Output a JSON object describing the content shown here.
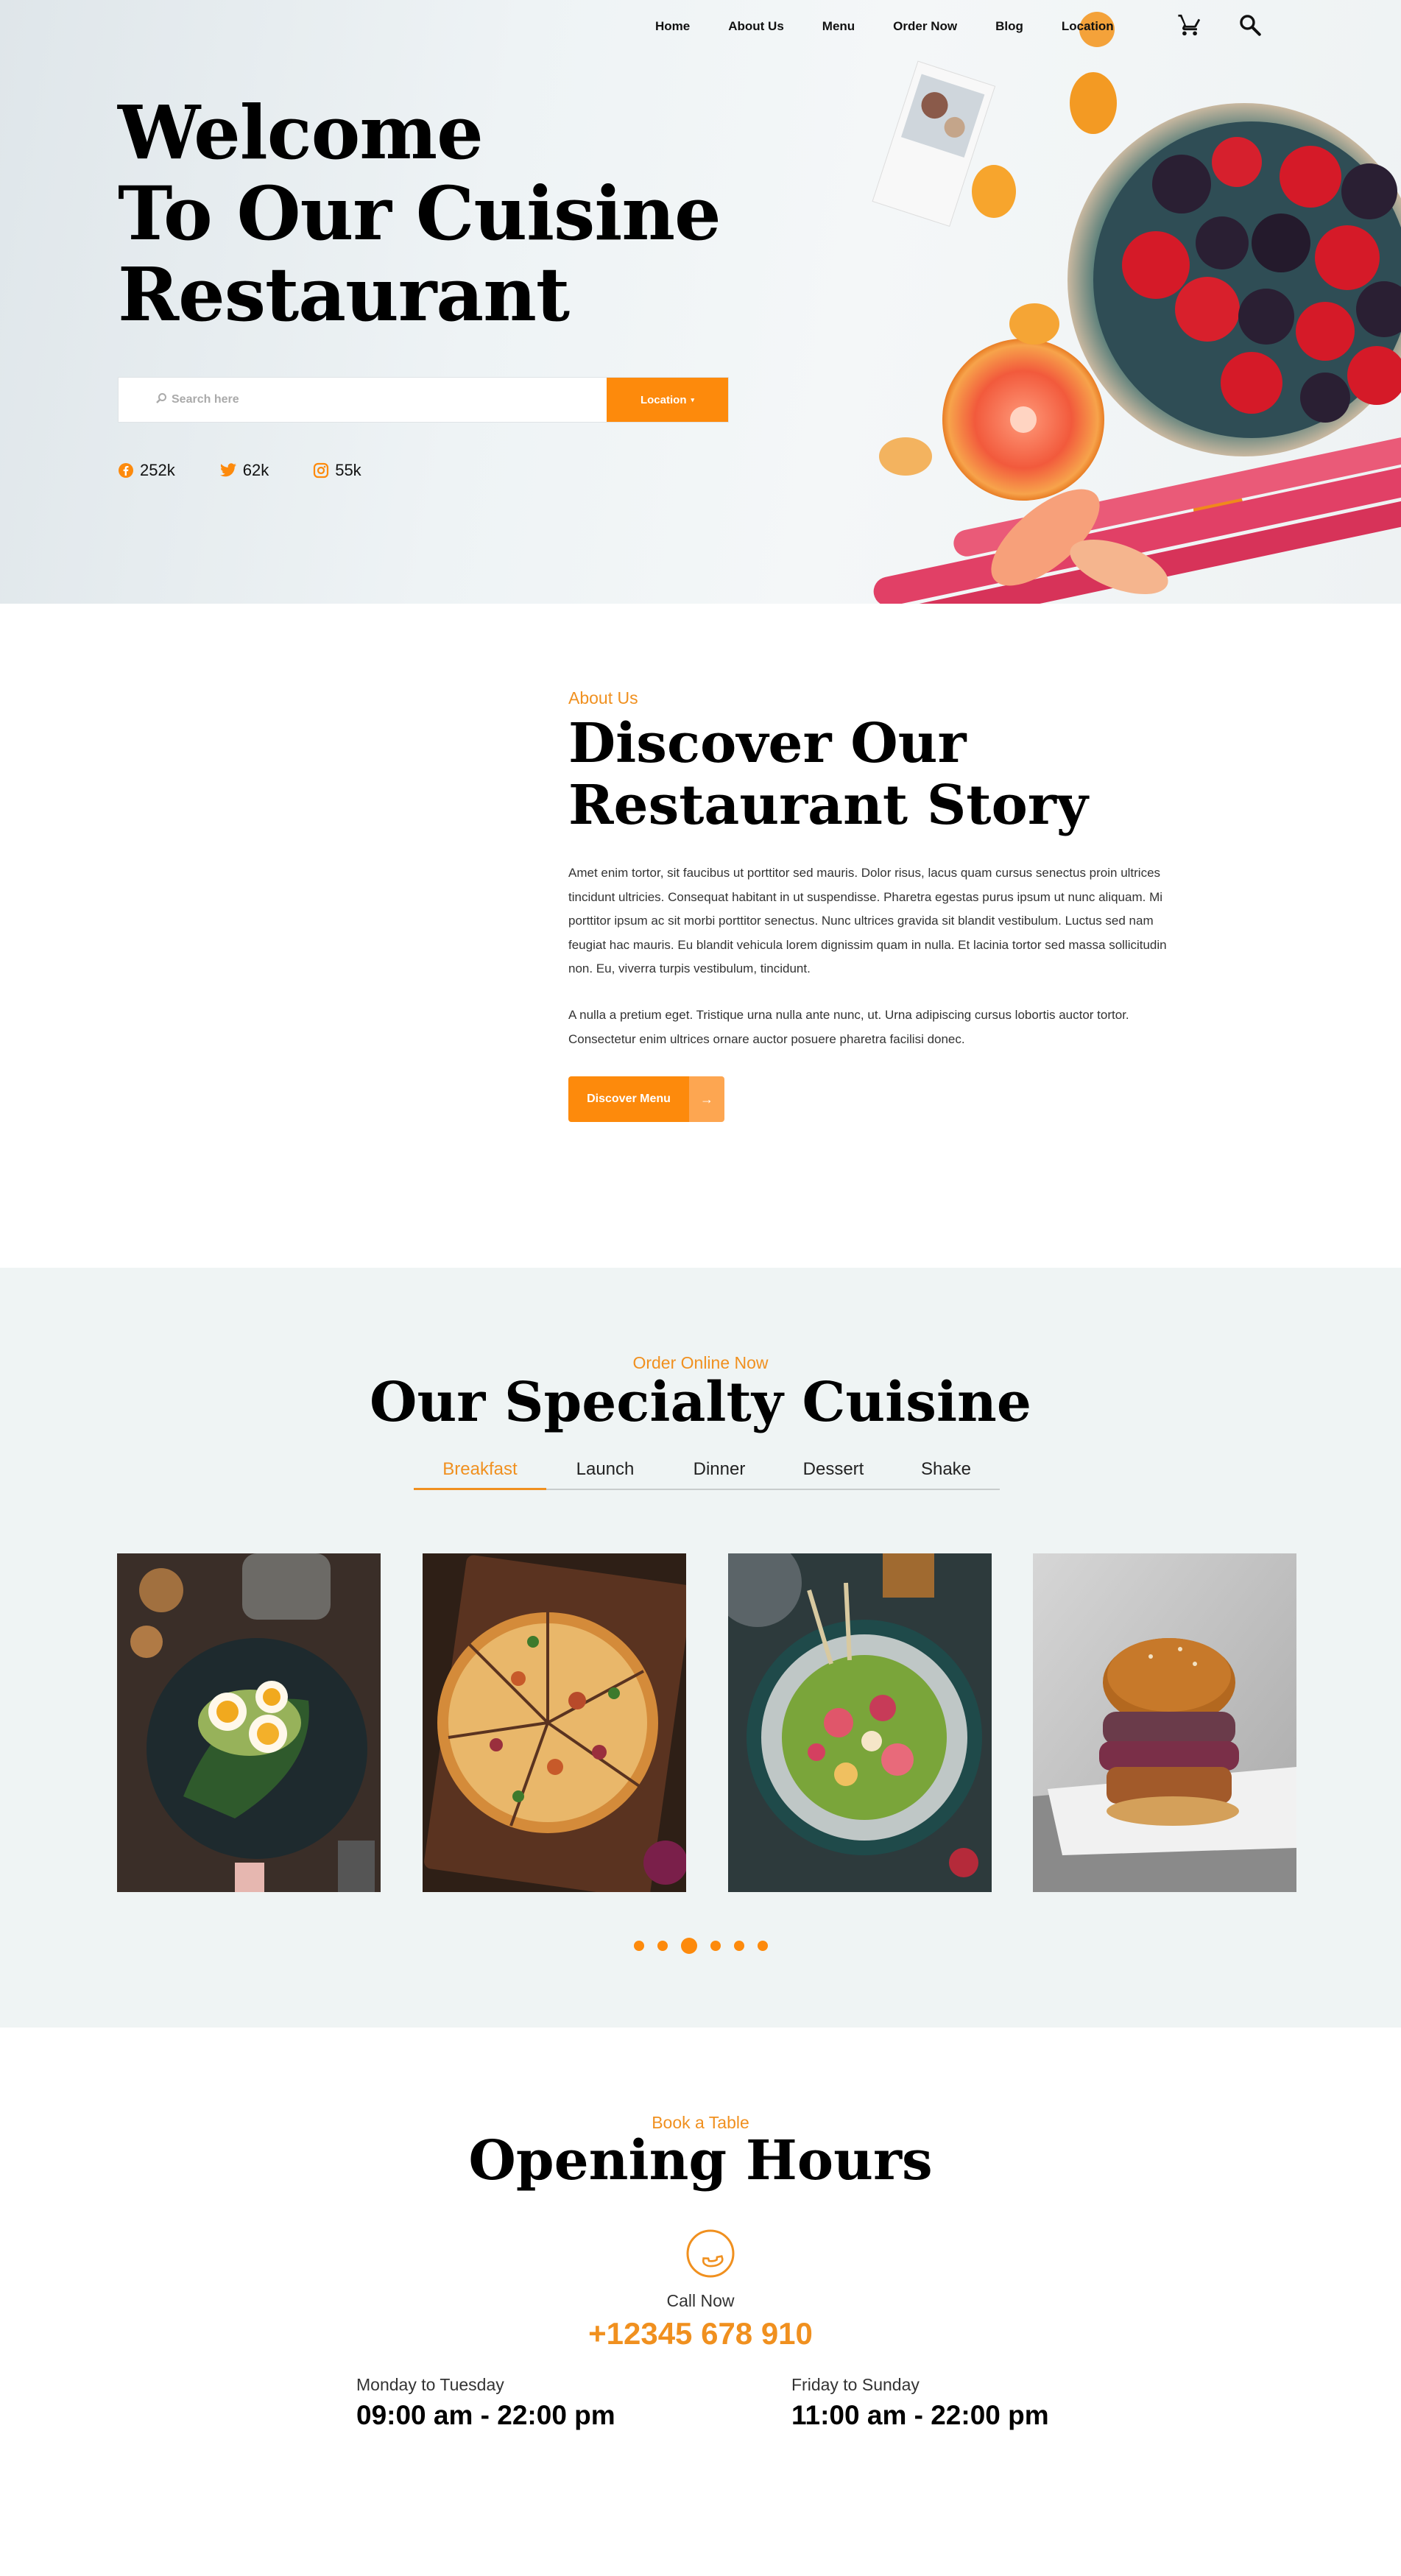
{
  "nav": {
    "links": [
      "Home",
      "About Us",
      "Menu",
      "Order Now",
      "Blog",
      "Location"
    ],
    "cart_icon": "cart-icon",
    "search_icon": "search-icon"
  },
  "hero": {
    "title_lines": [
      "Welcome",
      "To Our Cuisine",
      "Restaurant"
    ],
    "search_placeholder": "Search here",
    "location_button": "Location",
    "socials": [
      {
        "network": "facebook",
        "count": "252k"
      },
      {
        "network": "twitter",
        "count": "62k"
      },
      {
        "network": "instagram",
        "count": "55k"
      }
    ]
  },
  "about": {
    "eyebrow": "About Us",
    "title_lines": [
      "Discover Our",
      "Restaurant Story"
    ],
    "paragraph1": "Amet enim tortor, sit faucibus ut porttitor sed mauris. Dolor risus, lacus quam cursus senectus proin ultrices tincidunt ultricies. Consequat habitant in ut suspendisse. Pharetra egestas purus ipsum ut nunc aliquam. Mi porttitor ipsum ac sit morbi porttitor senectus. Nunc ultrices gravida sit blandit vestibulum. Luctus sed nam feugiat hac mauris. Eu blandit vehicula lorem dignissim quam in nulla. Et lacinia tortor sed massa sollicitudin non. Eu, viverra turpis vestibulum, tincidunt.",
    "paragraph2": "A nulla a pretium eget. Tristique urna nulla ante nunc, ut. Urna adipiscing cursus lobortis auctor tortor. Consectetur enim ultrices ornare auctor posuere pharetra facilisi donec.",
    "button": "Discover Menu",
    "button_arrow": "→"
  },
  "specialty": {
    "eyebrow": "Order Online Now",
    "title": "Our Specialty Cuisine",
    "tabs": [
      "Breakfast",
      "Launch",
      "Dinner",
      "Dessert",
      "Shake"
    ],
    "active_tab": "Breakfast",
    "dishes": [
      "egg-avocado-toast",
      "pizza",
      "salad-bowl",
      "burger"
    ],
    "dots_count": 6,
    "active_dot": 2
  },
  "hours": {
    "eyebrow": "Book a Table",
    "title": "Opening Hours",
    "call_label": "Call Now",
    "phone": "+12345 678 910",
    "schedule": [
      {
        "days": "Monday to Tuesday",
        "time": "09:00 am - 22:00 pm"
      },
      {
        "days": "Friday to Sunday",
        "time": "11:00 am - 22:00 pm"
      }
    ]
  },
  "colors": {
    "accent": "#fd8a0c",
    "accent_text": "#f0901f",
    "section_bg": "#eff4f4"
  }
}
